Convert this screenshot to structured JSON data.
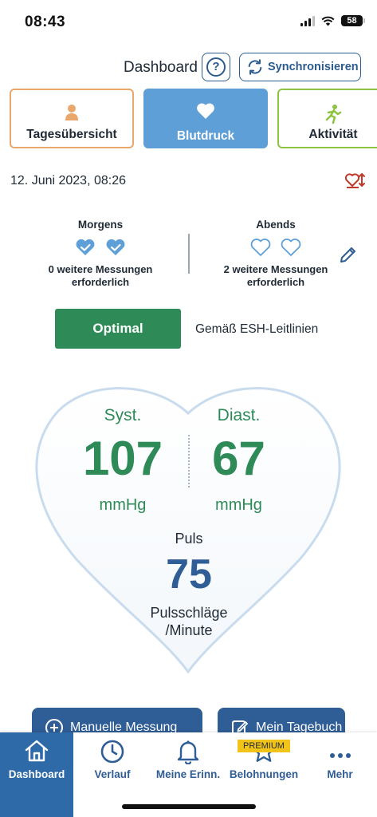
{
  "status_bar": {
    "time": "08:43",
    "battery": "58"
  },
  "header": {
    "title": "Dashboard",
    "help": "?",
    "sync_label": "Synchronisieren"
  },
  "tabs": [
    {
      "label": "Tagesübersicht"
    },
    {
      "label": "Blutdruck"
    },
    {
      "label": "Aktivität"
    }
  ],
  "date_time": "12. Juni 2023, 08:26",
  "measurements": {
    "morning": {
      "title": "Morgens",
      "note_line1": "0 weitere Messungen",
      "note_line2": "erforderlich"
    },
    "evening": {
      "title": "Abends",
      "note_line1": "2 weitere Messungen",
      "note_line2": "erforderlich"
    }
  },
  "status": {
    "label": "Optimal",
    "guideline": "Gemäß ESH-Leitlinien"
  },
  "reading": {
    "systolic": {
      "label": "Syst.",
      "value": "107",
      "unit": "mmHg"
    },
    "diastolic": {
      "label": "Diast.",
      "value": "67",
      "unit": "mmHg"
    },
    "pulse": {
      "label": "Puls",
      "value": "75",
      "unit_line1": "Pulsschläge",
      "unit_line2": "/Minute"
    }
  },
  "actions": {
    "manual": "Manuelle Messung",
    "diary": "Mein Tagebuch"
  },
  "nav": {
    "dashboard": "Dashboard",
    "history": "Verlauf",
    "reminders": "Meine Erinn.",
    "rewards": "Belohnungen",
    "rewards_badge": "PREMIUM",
    "more": "Mehr"
  },
  "colors": {
    "primary": "#2f5d96",
    "optimal_green": "#2e8b57",
    "tab_active": "#5d9fd6",
    "overview_border": "#e9a76c",
    "activity_border": "#8cc43f"
  }
}
